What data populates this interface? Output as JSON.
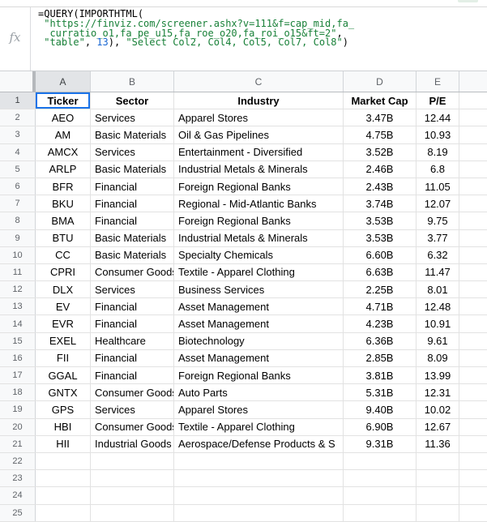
{
  "colors": {
    "selection_blue": "#1a73e8",
    "formula_string_green": "#188038",
    "formula_number_blue": "#1967d2",
    "formula_default": "#000000",
    "header_highlight": "#e2e4e7",
    "share_chip_green": "#e3efe6"
  },
  "formula_bar": {
    "fx_label": "fx",
    "lines": [
      {
        "segments": [
          {
            "text": "=QUERY(IMPORTHTML(",
            "color": "default"
          }
        ]
      },
      {
        "segments": [
          {
            "text": " ",
            "color": "default"
          },
          {
            "text": "\"https://finviz.com/screener.ashx?v=111&f=cap_mid,fa_",
            "color": "string"
          }
        ]
      },
      {
        "segments": [
          {
            "text": "  ",
            "color": "default"
          },
          {
            "text": "curratio_o1,fa_pe_u15,fa_roe_o20,fa_roi_o15&ft=2\"",
            "color": "string"
          },
          {
            "text": ",",
            "color": "default"
          }
        ]
      },
      {
        "segments": [
          {
            "text": " ",
            "color": "default"
          },
          {
            "text": "\"table\"",
            "color": "string"
          },
          {
            "text": ", ",
            "color": "default"
          },
          {
            "text": "13",
            "color": "number"
          },
          {
            "text": "), ",
            "color": "default"
          },
          {
            "text": "\"Select Col2, Col4, Col5, Col7, Col8\"",
            "color": "string"
          },
          {
            "text": ")",
            "color": "default"
          }
        ]
      }
    ]
  },
  "grid": {
    "column_letters": [
      "A",
      "B",
      "C",
      "D",
      "E"
    ],
    "selected": {
      "cell": "A1",
      "column": "A",
      "row": "1"
    },
    "header_row": {
      "row_number": "1",
      "cells": [
        "Ticker",
        "Sector",
        "Industry",
        "Market Cap",
        "P/E"
      ]
    },
    "data_rows": [
      {
        "row_number": "2",
        "ticker": "AEO",
        "sector": "Services",
        "industry": "Apparel Stores",
        "market_cap": "3.47B",
        "pe": "12.44"
      },
      {
        "row_number": "3",
        "ticker": "AM",
        "sector": "Basic Materials",
        "industry": "Oil & Gas Pipelines",
        "market_cap": "4.75B",
        "pe": "10.93"
      },
      {
        "row_number": "4",
        "ticker": "AMCX",
        "sector": "Services",
        "industry": "Entertainment - Diversified",
        "market_cap": "3.52B",
        "pe": "8.19"
      },
      {
        "row_number": "5",
        "ticker": "ARLP",
        "sector": "Basic Materials",
        "industry": "Industrial Metals & Minerals",
        "market_cap": "2.46B",
        "pe": "6.8"
      },
      {
        "row_number": "6",
        "ticker": "BFR",
        "sector": "Financial",
        "industry": "Foreign Regional Banks",
        "market_cap": "2.43B",
        "pe": "11.05"
      },
      {
        "row_number": "7",
        "ticker": "BKU",
        "sector": "Financial",
        "industry": "Regional - Mid-Atlantic Banks",
        "market_cap": "3.74B",
        "pe": "12.07"
      },
      {
        "row_number": "8",
        "ticker": "BMA",
        "sector": "Financial",
        "industry": "Foreign Regional Banks",
        "market_cap": "3.53B",
        "pe": "9.75"
      },
      {
        "row_number": "9",
        "ticker": "BTU",
        "sector": "Basic Materials",
        "industry": "Industrial Metals & Minerals",
        "market_cap": "3.53B",
        "pe": "3.77"
      },
      {
        "row_number": "10",
        "ticker": "CC",
        "sector": "Basic Materials",
        "industry": "Specialty Chemicals",
        "market_cap": "6.60B",
        "pe": "6.32"
      },
      {
        "row_number": "11",
        "ticker": "CPRI",
        "sector": "Consumer Goods",
        "industry": "Textile - Apparel Clothing",
        "market_cap": "6.63B",
        "pe": "11.47"
      },
      {
        "row_number": "12",
        "ticker": "DLX",
        "sector": "Services",
        "industry": "Business Services",
        "market_cap": "2.25B",
        "pe": "8.01"
      },
      {
        "row_number": "13",
        "ticker": "EV",
        "sector": "Financial",
        "industry": "Asset Management",
        "market_cap": "4.71B",
        "pe": "12.48"
      },
      {
        "row_number": "14",
        "ticker": "EVR",
        "sector": "Financial",
        "industry": "Asset Management",
        "market_cap": "4.23B",
        "pe": "10.91"
      },
      {
        "row_number": "15",
        "ticker": "EXEL",
        "sector": "Healthcare",
        "industry": "Biotechnology",
        "market_cap": "6.36B",
        "pe": "9.61"
      },
      {
        "row_number": "16",
        "ticker": "FII",
        "sector": "Financial",
        "industry": "Asset Management",
        "market_cap": "2.85B",
        "pe": "8.09"
      },
      {
        "row_number": "17",
        "ticker": "GGAL",
        "sector": "Financial",
        "industry": "Foreign Regional Banks",
        "market_cap": "3.81B",
        "pe": "13.99"
      },
      {
        "row_number": "18",
        "ticker": "GNTX",
        "sector": "Consumer Goods",
        "industry": "Auto Parts",
        "market_cap": "5.31B",
        "pe": "12.31"
      },
      {
        "row_number": "19",
        "ticker": "GPS",
        "sector": "Services",
        "industry": "Apparel Stores",
        "market_cap": "9.40B",
        "pe": "10.02"
      },
      {
        "row_number": "20",
        "ticker": "HBI",
        "sector": "Consumer Goods",
        "industry": "Textile - Apparel Clothing",
        "market_cap": "6.90B",
        "pe": "12.67"
      },
      {
        "row_number": "21",
        "ticker": "HII",
        "sector": "Industrial Goods",
        "industry": "Aerospace/Defense Products & S",
        "market_cap": "9.31B",
        "pe": "11.36"
      }
    ],
    "empty_row_numbers": [
      "22",
      "23",
      "24",
      "25"
    ]
  }
}
